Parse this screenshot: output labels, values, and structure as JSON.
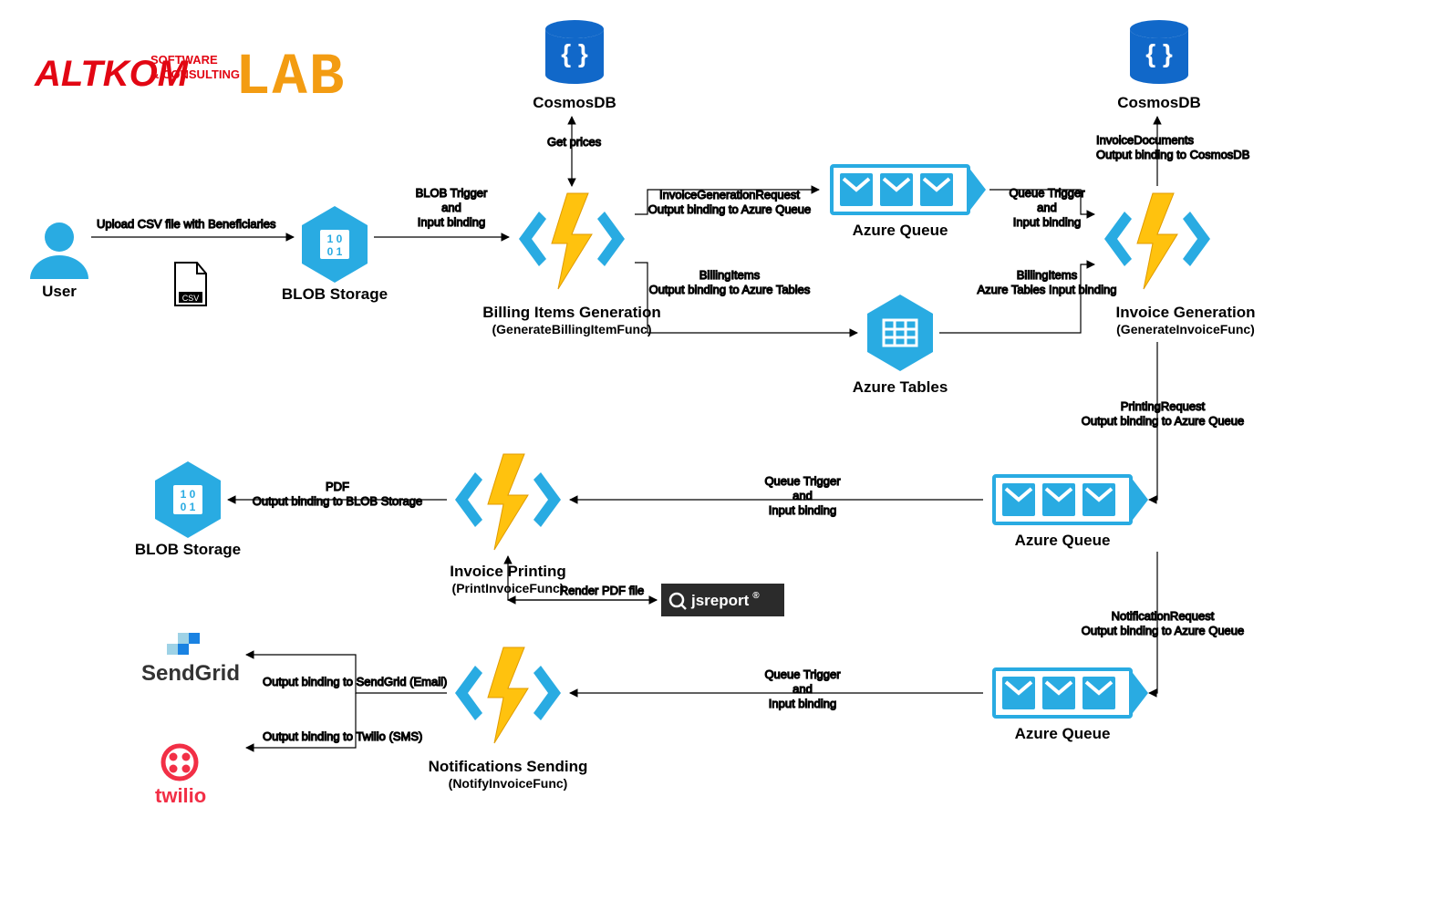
{
  "logo": {
    "brand_top": "ALTKOM",
    "brand_small1": "SOFTWARE",
    "brand_small2": "& CONSULTING",
    "lab": "LAB"
  },
  "nodes": {
    "user": {
      "title": "User"
    },
    "csv": {
      "label": "CSV"
    },
    "blob1": {
      "title": "BLOB Storage"
    },
    "func_billing": {
      "title": "Billing Items Generation",
      "sub": "(GenerateBillingItemFunc)"
    },
    "cosmos1": {
      "title": "CosmosDB"
    },
    "queue1": {
      "title": "Azure Queue"
    },
    "tables": {
      "title": "Azure Tables"
    },
    "func_invoice": {
      "title": "Invoice Generation",
      "sub": "(GenerateInvoiceFunc)"
    },
    "cosmos2": {
      "title": "CosmosDB"
    },
    "queue2": {
      "title": "Azure Queue"
    },
    "func_print": {
      "title": "Invoice Printing",
      "sub": "(PrintInvoiceFunc)"
    },
    "blob2": {
      "title": "BLOB Storage"
    },
    "jsreport": {
      "label": "jsreport",
      "reg": "®"
    },
    "queue3": {
      "title": "Azure Queue"
    },
    "func_notify": {
      "title": "Notifications Sending",
      "sub": "(NotifyInvoiceFunc)"
    },
    "sendgrid": {
      "label": "SendGrid"
    },
    "twilio": {
      "label": "twilio"
    }
  },
  "edges": {
    "upload_csv": "Upload CSV file with Beneficiaries",
    "blob_trigger": {
      "l1": "BLOB Trigger",
      "l2": "and",
      "l3": "Input binding"
    },
    "get_prices": "Get prices",
    "to_queue1": {
      "l1": "InvoiceGenerationRequest",
      "l2": "Output binding to Azure Queue"
    },
    "to_tables": {
      "l1": "BillingItems",
      "l2": "Output binding to Azure Tables"
    },
    "queue_trigger": {
      "l1": "Queue Trigger",
      "l2": "and",
      "l3": "Input binding"
    },
    "tables_input": {
      "l1": "BillingItems",
      "l2": "Azure Tables Input binding"
    },
    "cosmos2_out": {
      "l1": "InvoiceDocuments",
      "l2": "Output binding to CosmosDB"
    },
    "printing_req": {
      "l1": "PrintingRequest",
      "l2": "Output binding to Azure Queue"
    },
    "queue_trigger2": {
      "l1": "Queue Trigger",
      "l2": "and",
      "l3": "Input binding"
    },
    "pdf_out": {
      "l1": "PDF",
      "l2": "Output binding to BLOB Storage"
    },
    "render_pdf": "Render PDF file",
    "notify_req": {
      "l1": "NotificationRequest",
      "l2": "Output binding to Azure Queue"
    },
    "queue_trigger3": {
      "l1": "Queue Trigger",
      "l2": "and",
      "l3": "Input binding"
    },
    "sendgrid_out": "Output binding to SendGrid (Email)",
    "twilio_out": "Output binding to Twilio (SMS)"
  }
}
